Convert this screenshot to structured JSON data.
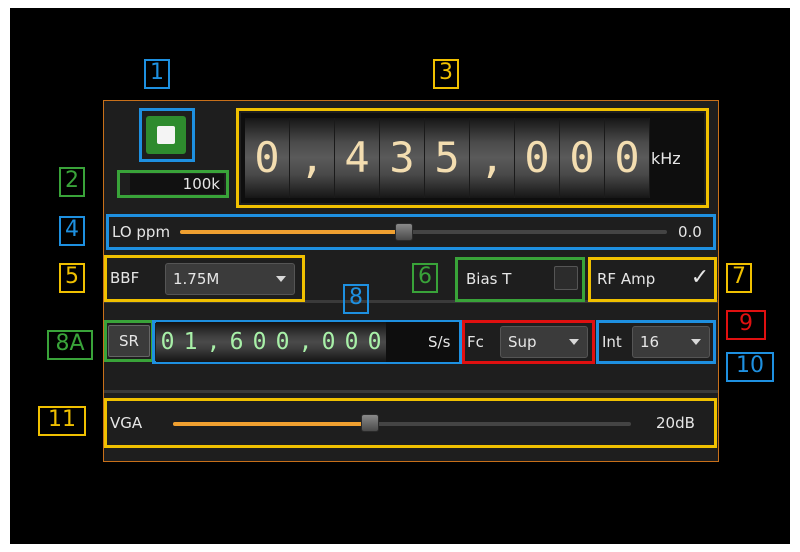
{
  "callouts": {
    "c1": "1",
    "c2": "2",
    "c3": "3",
    "c4": "4",
    "c5": "5",
    "c6": "6",
    "c7": "7",
    "c8": "8",
    "c8a": "8A",
    "c9": "9",
    "c10": "10",
    "c11": "11"
  },
  "center_frequency": {
    "digits": [
      "0",
      ",",
      "4",
      "3",
      "5",
      ",",
      "0",
      "0",
      "0"
    ],
    "unit": "kHz"
  },
  "decimation_display": "100k",
  "lo_ppm": {
    "label": "LO ppm",
    "value": "0.0",
    "level": 0.46
  },
  "bbf": {
    "label": "BBF",
    "value": "1.75M"
  },
  "bias_t": {
    "label": "Bias T",
    "checked": false
  },
  "rf_amp": {
    "label": "RF Amp",
    "check": "✓",
    "checked": true
  },
  "sample_rate": {
    "button": "SR",
    "digits": [
      "0",
      "1",
      ",",
      "6",
      "0",
      "0",
      ",",
      "0",
      "0",
      "0"
    ],
    "unit": "S/s"
  },
  "fc": {
    "label": "Fc",
    "value": "Sup"
  },
  "interp": {
    "label": "Int",
    "value": "16"
  },
  "vga": {
    "label": "VGA",
    "value": "20dB",
    "level": 0.43
  },
  "colors": {
    "accent": "#f0a030",
    "border": "#c8701a",
    "green": "#39a339",
    "blue": "#1e90e0",
    "yellow": "#f0c000",
    "red": "#e01010"
  }
}
